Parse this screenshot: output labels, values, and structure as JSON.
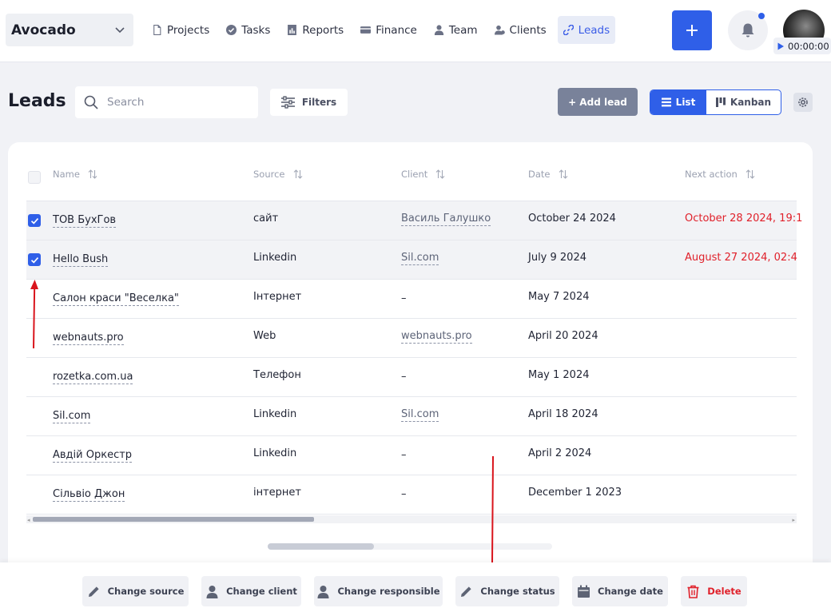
{
  "workspace": {
    "name": "Avocado"
  },
  "nav": [
    {
      "label": "Projects",
      "icon": "document-icon",
      "active": false
    },
    {
      "label": "Tasks",
      "icon": "check-circle-icon",
      "active": false
    },
    {
      "label": "Reports",
      "icon": "report-icon",
      "active": false
    },
    {
      "label": "Finance",
      "icon": "wallet-icon",
      "active": false
    },
    {
      "label": "Team",
      "icon": "user-icon",
      "active": false
    },
    {
      "label": "Clients",
      "icon": "clients-icon",
      "active": false
    },
    {
      "label": "Leads",
      "icon": "leads-icon",
      "active": true
    }
  ],
  "header": {
    "timer": "00:00:00"
  },
  "page": {
    "title": "Leads",
    "search_placeholder": "Search",
    "filters_label": "Filters",
    "add_lead_label": "+ Add lead",
    "view_list_label": "List",
    "view_kanban_label": "Kanban"
  },
  "table": {
    "columns": [
      "Name",
      "Source",
      "Client",
      "Date",
      "Next action"
    ],
    "rows": [
      {
        "selected": true,
        "name": "ТОВ БухГов",
        "source": "сайт",
        "client": "Василь Галушко",
        "client_link": true,
        "date": "October 24 2024",
        "next_action": "October 28 2024, 19:1"
      },
      {
        "selected": true,
        "name": "Hello Bush",
        "source": "Linkedin",
        "client": "Sil.com",
        "client_link": true,
        "date": "July 9 2024",
        "next_action": "August 27 2024, 02:4"
      },
      {
        "selected": false,
        "name": "Салон краси \"Веселка\"",
        "source": "Інтернет",
        "client": "–",
        "client_link": false,
        "date": "May 7 2024",
        "next_action": ""
      },
      {
        "selected": false,
        "name": "webnauts.pro",
        "source": "Web",
        "client": "webnauts.pro",
        "client_link": true,
        "date": "April 20 2024",
        "next_action": ""
      },
      {
        "selected": false,
        "name": "rozetka.com.ua",
        "source": "Телефон",
        "client": "–",
        "client_link": false,
        "date": "May 1 2024",
        "next_action": ""
      },
      {
        "selected": false,
        "name": "Sil.com",
        "source": "Linkedin",
        "client": "Sil.com",
        "client_link": true,
        "date": "April 18 2024",
        "next_action": ""
      },
      {
        "selected": false,
        "name": "Авдій Оркестр",
        "source": "Linkedin",
        "client": "–",
        "client_link": false,
        "date": "April 2 2024",
        "next_action": ""
      },
      {
        "selected": false,
        "name": "Сільвіо Джон",
        "source": "інтернет",
        "client": "–",
        "client_link": false,
        "date": "December 1 2023",
        "next_action": ""
      }
    ]
  },
  "actions": [
    {
      "label": "Change source",
      "icon": "pencil-icon",
      "danger": false
    },
    {
      "label": "Change client",
      "icon": "person-icon",
      "danger": false
    },
    {
      "label": "Change responsible",
      "icon": "person-icon",
      "danger": false
    },
    {
      "label": "Change status",
      "icon": "pencil-icon",
      "danger": false
    },
    {
      "label": "Change date",
      "icon": "calendar-icon",
      "danger": false
    },
    {
      "label": "Delete",
      "icon": "trash-icon",
      "danger": true
    }
  ],
  "colors": {
    "accent": "#2f5fe8",
    "danger": "#e0202a",
    "background": "#f1f2f6",
    "annotation_arrow": "#d9141c"
  }
}
